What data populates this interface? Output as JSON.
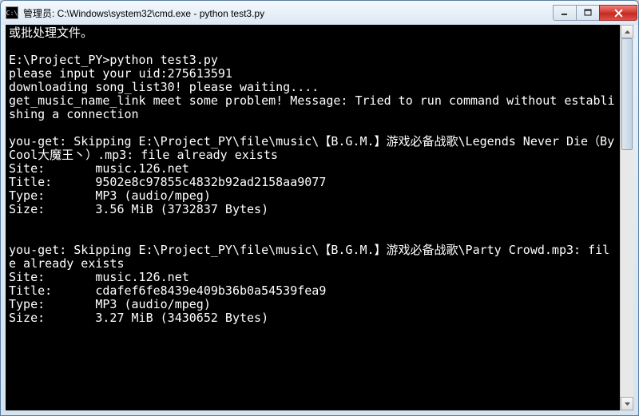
{
  "window": {
    "title": "管理员: C:\\Windows\\system32\\cmd.exe - python  test3.py",
    "icon_char": "C:\\"
  },
  "terminal": {
    "lines": [
      "或批处理文件。",
      "",
      "E:\\Project_PY>python test3.py",
      "please input your uid:275613591",
      "downloading song_list30! please waiting....",
      "get_music_name_link meet some problem! Message: Tried to run command without establishing a connection",
      "",
      "you-get: Skipping E:\\Project_PY\\file\\music\\【B.G.M.】游戏必备战歌\\Legends Never Die（By Cool大魔王丶）.mp3: file already exists",
      "Site:       music.126.net",
      "Title:      9502e8c97855c4832b92ad2158aa9077",
      "Type:       MP3 (audio/mpeg)",
      "Size:       3.56 MiB (3732837 Bytes)",
      "",
      "",
      "you-get: Skipping E:\\Project_PY\\file\\music\\【B.G.M.】游戏必备战歌\\Party Crowd.mp3: file already exists",
      "Site:       music.126.net",
      "Title:      cdafef6fe8439e409b36b0a54539fea9",
      "Type:       MP3 (audio/mpeg)",
      "Size:       3.27 MiB (3430652 Bytes)"
    ]
  }
}
